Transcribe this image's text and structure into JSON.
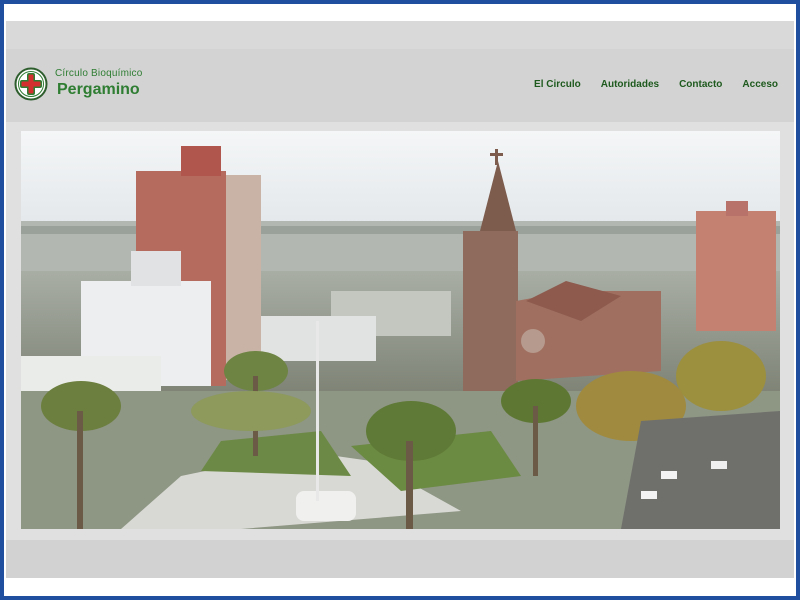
{
  "brand": {
    "subtitle": "Círculo  Bioquímico",
    "name": "Pergamino"
  },
  "nav": {
    "items": [
      {
        "label": "El Circulo"
      },
      {
        "label": "Autoridades"
      },
      {
        "label": "Contacto"
      },
      {
        "label": "Acceso"
      }
    ]
  },
  "hero": {
    "icon": "city-aerial-photo"
  },
  "colors": {
    "frame": "#1f4f9e",
    "brand_green": "#2e7d32",
    "nav_green": "#1e5a1e",
    "logo_red": "#d32f2f",
    "header_bg": "#d3d3d3"
  }
}
